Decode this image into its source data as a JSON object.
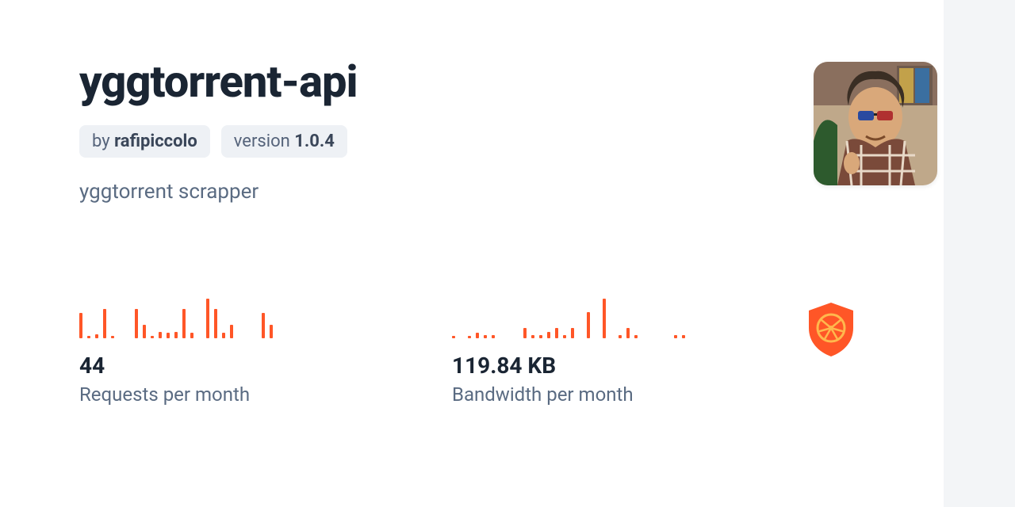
{
  "package": {
    "name": "yggtorrent-api",
    "by_prefix": "by ",
    "author": "rafipiccolo",
    "version_prefix": "version ",
    "version": "1.0.4",
    "description": "yggtorrent scrapper"
  },
  "chart_data": [
    {
      "type": "bar",
      "title": "Requests per month",
      "value_label": "44",
      "values": [
        19,
        2,
        3,
        22,
        2,
        0,
        0,
        22,
        10,
        2,
        5,
        4,
        5,
        22,
        4,
        0,
        30,
        22,
        4,
        10,
        0,
        0,
        0,
        19,
        10,
        0,
        0,
        0,
        0,
        0,
        0
      ],
      "color": "#ff5627"
    },
    {
      "type": "bar",
      "title": "Bandwidth per month",
      "value_label": "119.84 KB",
      "values": [
        2,
        0,
        2,
        5,
        3,
        3,
        0,
        0,
        0,
        9,
        3,
        3,
        6,
        9,
        3,
        9,
        0,
        24,
        0,
        36,
        0,
        3,
        9,
        3,
        0,
        0,
        0,
        0,
        3,
        3,
        0
      ],
      "color": "#ff5627"
    }
  ]
}
